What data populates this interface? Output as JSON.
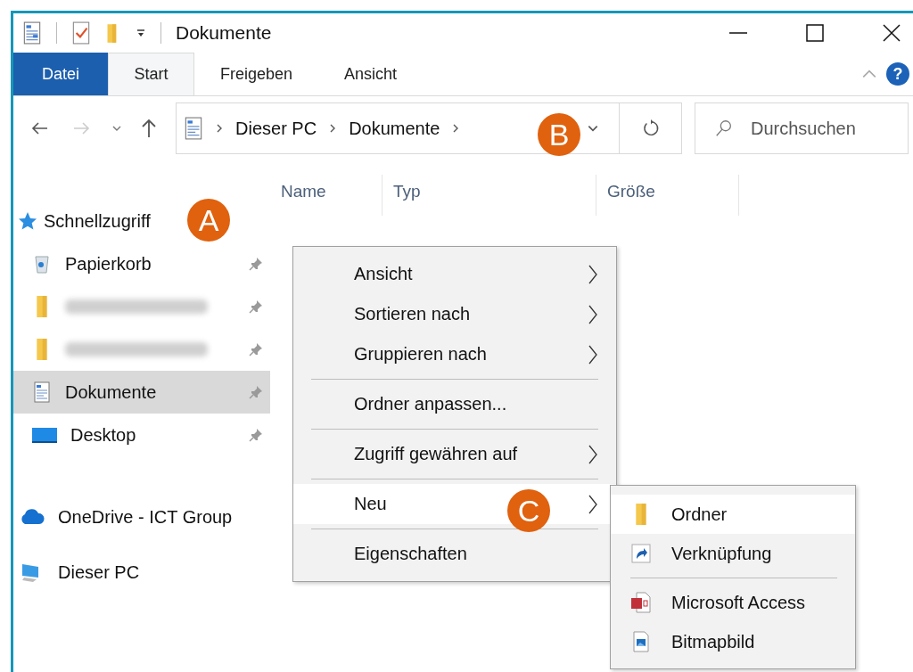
{
  "window": {
    "title": "Dokumente"
  },
  "ribbon": {
    "tabs": [
      {
        "label": "Datei",
        "kind": "file",
        "selected": false
      },
      {
        "label": "Start",
        "kind": "tab",
        "selected": true
      },
      {
        "label": "Freigeben",
        "kind": "tab",
        "selected": false
      },
      {
        "label": "Ansicht",
        "kind": "tab",
        "selected": false
      }
    ],
    "help_label": "?"
  },
  "navigation": {
    "forward_disabled": true
  },
  "address_bar": {
    "path": [
      "Dieser PC",
      "Dokumente"
    ]
  },
  "search": {
    "placeholder": "Durchsuchen"
  },
  "sidebar": {
    "quick_access": {
      "label": "Schnellzugriff",
      "items": [
        {
          "label": "Papierkorb",
          "kind": "recycle",
          "blurred": false,
          "pinned": true,
          "selected": false
        },
        {
          "kind": "folder",
          "blurred": true,
          "pinned": true,
          "selected": false
        },
        {
          "kind": "folder",
          "blurred": true,
          "pinned": true,
          "selected": false
        },
        {
          "label": "Dokumente",
          "kind": "document",
          "blurred": false,
          "pinned": true,
          "selected": true
        },
        {
          "label": "Desktop",
          "kind": "desktop",
          "blurred": false,
          "pinned": true,
          "selected": false
        }
      ]
    },
    "locations": [
      {
        "label": "OneDrive - ICT Group",
        "kind": "cloud"
      },
      {
        "label": "Dieser PC",
        "kind": "computer"
      }
    ]
  },
  "columns": [
    "Name",
    "Typ",
    "Größe"
  ],
  "context_menu": {
    "groups": [
      [
        {
          "label": "Ansicht",
          "submenu": true,
          "selected": false
        },
        {
          "label": "Sortieren nach",
          "submenu": true,
          "selected": false
        },
        {
          "label": "Gruppieren nach",
          "submenu": true,
          "selected": false
        }
      ],
      [
        {
          "label": "Ordner anpassen...",
          "submenu": false,
          "selected": false
        }
      ],
      [
        {
          "label": "Zugriff gewähren auf",
          "submenu": true,
          "selected": false
        }
      ],
      [
        {
          "label": "Neu",
          "submenu": true,
          "selected": true
        }
      ],
      [
        {
          "label": "Eigenschaften",
          "submenu": false,
          "selected": false
        }
      ]
    ]
  },
  "submenu": {
    "groups": [
      [
        {
          "label": "Ordner",
          "kind": "folder",
          "selected": true
        },
        {
          "label": "Verknüpfung",
          "kind": "shortcut",
          "selected": false
        }
      ],
      [
        {
          "label": "Microsoft Access",
          "kind": "database",
          "selected": false
        },
        {
          "label": "Bitmapbild",
          "kind": "image",
          "selected": false
        }
      ]
    ]
  },
  "annotations": [
    "A",
    "B",
    "C"
  ]
}
